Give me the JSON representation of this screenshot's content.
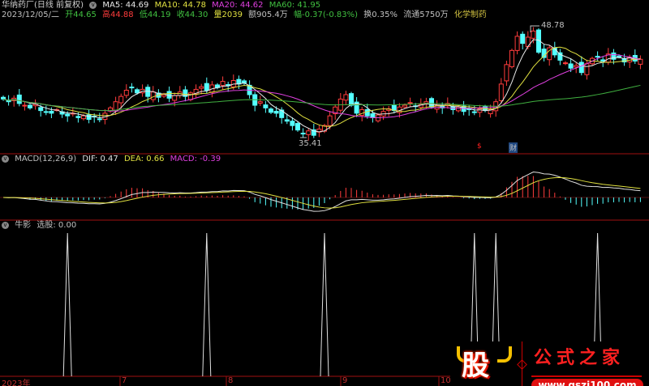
{
  "header": {
    "title": "华纳药厂(日线 前复权)",
    "ma5": "MA5: 44.69",
    "ma10": "MA10: 44.78",
    "ma20": "MA20: 44.62",
    "ma60": "MA60: 41.95",
    "date": "2023/12/05/二",
    "open": "开44.65",
    "high": "高44.88",
    "low": "低44.19",
    "close": "收44.30",
    "volume": "量2039",
    "amount": "额905.4万",
    "change": "幅-0.37(-0.83%)",
    "turnover": "换0.35%",
    "float": "流通5750万",
    "sector": "化学制药"
  },
  "price_annotations": {
    "max_label": "48.78",
    "min_label": "35.41",
    "marker_red": "$",
    "marker_fin": "财"
  },
  "macd": {
    "title": "MACD(12,26,9)",
    "dif": "DIF: 0.47",
    "dea": "DEA: 0.66",
    "macd": "MACD: -0.39"
  },
  "signal_panel": {
    "title": "牛影",
    "value": "选股: 0.00"
  },
  "xaxis": {
    "labels": [
      "2023年",
      "7",
      "8",
      "9",
      "10"
    ]
  },
  "logo": {
    "char": "股",
    "brand": "公式之家",
    "url": "www.gszj100.com"
  },
  "colors": {
    "up": "#ff3c3c",
    "down": "#54ffff",
    "ma5": "#e8e8e8",
    "ma10": "#e0e040",
    "ma20": "#e040e0",
    "ma60": "#40b040",
    "grid": "#a01010"
  },
  "chart_data": {
    "type": "candlestick",
    "closes": [
      40.5,
      40.2,
      40.6,
      40.0,
      39.8,
      39.5,
      39.9,
      39.2,
      39.0,
      38.9,
      39.3,
      38.8,
      38.6,
      38.9,
      38.4,
      38.6,
      38.2,
      38.5,
      38.2,
      38.9,
      39.5,
      40.2,
      40.8,
      41.5,
      41.8,
      41.2,
      41.6,
      40.8,
      41.3,
      40.7,
      41.0,
      40.6,
      40.9,
      41.3,
      40.8,
      41.2,
      41.6,
      41.9,
      41.5,
      42.1,
      41.8,
      42.5,
      42.0,
      42.6,
      42.2,
      42.3,
      41.0,
      39.8,
      40.2,
      39.5,
      39.0,
      38.9,
      38.4,
      38.0,
      37.5,
      37.0,
      36.6,
      36.9,
      36.4,
      37.1,
      37.5,
      38.6,
      39.6,
      40.5,
      41.0,
      39.8,
      38.9,
      39.3,
      38.6,
      38.4,
      38.7,
      39.1,
      39.4,
      39.2,
      39.6,
      39.8,
      40.1,
      39.7,
      39.9,
      40.2,
      39.6,
      39.8,
      39.5,
      40.0,
      39.3,
      39.6,
      39.1,
      39.3,
      39.0,
      39.4,
      39.2,
      39.3,
      40.2,
      42.2,
      44.4,
      46.0,
      47.6,
      46.8,
      47.5,
      48.2,
      45.8,
      45.2,
      46.3,
      45.5,
      44.9,
      44.6,
      44.0,
      44.3,
      43.5,
      44.5,
      45.1,
      45.3,
      44.8,
      45.6,
      45.0,
      45.3,
      44.7,
      45.2,
      44.8,
      45.0
    ],
    "price_range": [
      35.41,
      48.78
    ],
    "signal_bars": [
      12,
      38,
      60,
      88,
      92,
      111
    ]
  }
}
